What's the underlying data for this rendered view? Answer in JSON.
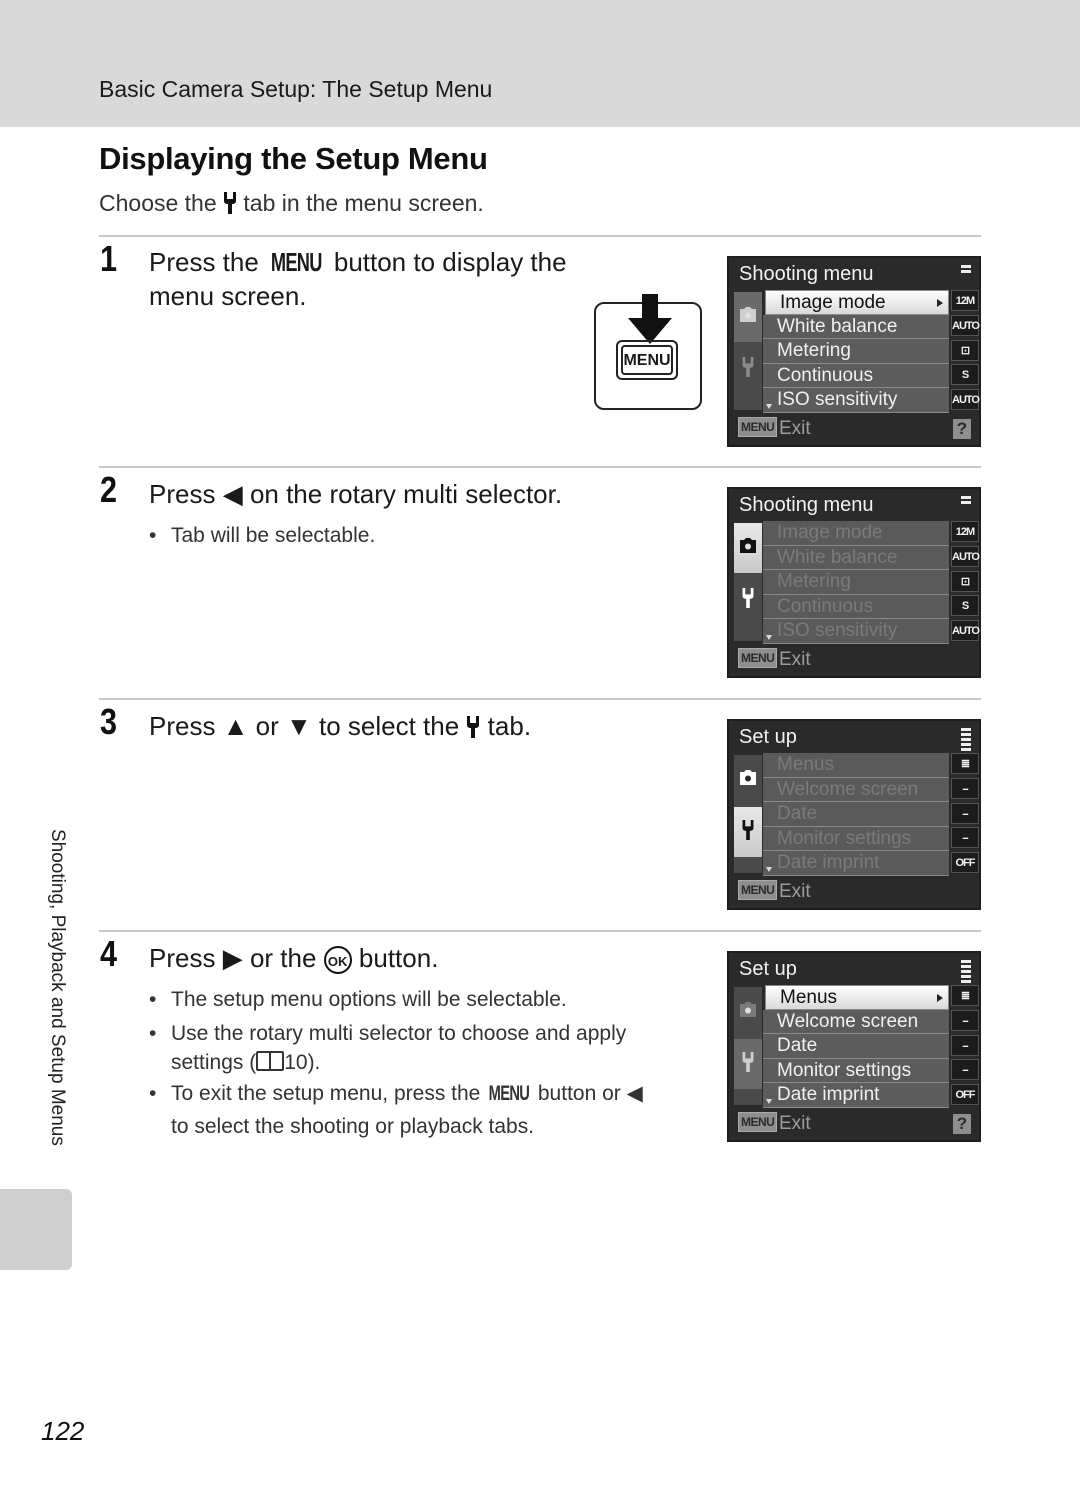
{
  "header": {
    "title": "Basic Camera Setup: The Setup Menu"
  },
  "page": {
    "title": "Displaying the Setup Menu",
    "intro_before": "Choose the",
    "intro_after": "tab in the menu screen.",
    "intro_icon": "wrench-icon",
    "page_number": "122",
    "side_label": "Shooting, Playback and Setup Menus"
  },
  "steps": [
    {
      "number": "1",
      "text_before": "Press the",
      "button": "MENU",
      "text_after": "button to display the menu screen.",
      "illustration_label": "MENU"
    },
    {
      "number": "2",
      "text_before": "Press",
      "glyph": "◀",
      "text_after": "on the rotary multi selector.",
      "bullets": [
        "Tab will be selectable."
      ]
    },
    {
      "number": "3",
      "text_before": "Press",
      "glyph_up": "▲",
      "or": "or",
      "glyph_down": "▼",
      "text_mid": "to select the",
      "text_after": "tab."
    },
    {
      "number": "4",
      "text_before": "Press",
      "glyph": "▶",
      "text_mid": "or the",
      "ok": "OK",
      "text_after": "button.",
      "bullets": [
        "The setup menu options will be selectable.",
        {
          "line1": "Use the rotary multi selector to choose and apply",
          "line2_before": "settings (",
          "ref": "10",
          "line2_after": ")."
        },
        {
          "line1_before": "To exit the setup menu, press the",
          "button": "MENU",
          "line1_mid": "button or",
          "glyph": "◀",
          "line2": "to select the shooting or playback tabs."
        }
      ]
    }
  ],
  "screens": [
    {
      "title": "Shooting menu",
      "active_tab": "camera",
      "rows_dimmed": false,
      "selected": 0,
      "rows": [
        "Image mode",
        "White balance",
        "Metering",
        "Continuous",
        "ISO sensitivity"
      ],
      "icons": [
        "12M",
        "AUTO",
        "⊡",
        "S",
        "AUTO"
      ],
      "footer_button": "MENU",
      "footer_text": "Exit",
      "help": "?"
    },
    {
      "title": "Shooting menu",
      "active_tab": "camera-highlight",
      "rows_dimmed": true,
      "selected": -1,
      "rows": [
        "Image mode",
        "White balance",
        "Metering",
        "Continuous",
        "ISO sensitivity"
      ],
      "icons": [
        "12M",
        "AUTO",
        "⊡",
        "S",
        "AUTO"
      ],
      "footer_button": "MENU",
      "footer_text": "Exit",
      "help": ""
    },
    {
      "title": "Set up",
      "active_tab": "setup-highlight",
      "rows_dimmed": true,
      "selected": -1,
      "rows": [
        "Menus",
        "Welcome screen",
        "Date",
        "Monitor settings",
        "Date imprint"
      ],
      "icons": [
        "≣",
        "--",
        "--",
        "--",
        "OFF"
      ],
      "footer_button": "MENU",
      "footer_text": "Exit",
      "help": ""
    },
    {
      "title": "Set up",
      "active_tab": "setup",
      "rows_dimmed": false,
      "selected": 0,
      "rows": [
        "Menus",
        "Welcome screen",
        "Date",
        "Monitor settings",
        "Date imprint"
      ],
      "icons": [
        "≣",
        "--",
        "--",
        "--",
        "OFF"
      ],
      "footer_button": "MENU",
      "footer_text": "Exit",
      "help": "?"
    }
  ]
}
